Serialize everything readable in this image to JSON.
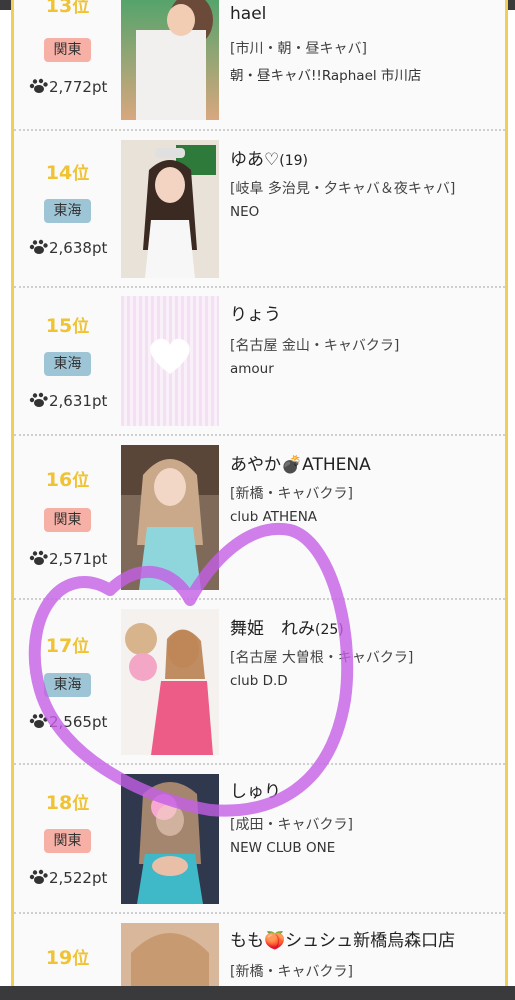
{
  "colors": {
    "rank": "#efc333",
    "kanto_badge": "#f7b0a6",
    "tokai_badge": "#9ec5d6",
    "frame": "#f0cf55",
    "scribble": "#c45fe6"
  },
  "entries": [
    {
      "rank_num": "13",
      "rank_unit": "位",
      "region": "関東",
      "points": "2,772pt",
      "name": "hael",
      "age": "",
      "area": "[市川・朝・昼キャバ]",
      "store": "朝・昼キャバ!!Raphael 市川店"
    },
    {
      "rank_num": "14",
      "rank_unit": "位",
      "region": "東海",
      "points": "2,638pt",
      "name": "ゆあ♡",
      "age": "(19)",
      "area": "[岐阜 多治見・夕キャバ＆夜キャバ]",
      "store": "NEO"
    },
    {
      "rank_num": "15",
      "rank_unit": "位",
      "region": "東海",
      "points": "2,631pt",
      "name": "りょう",
      "age": "",
      "area": "[名古屋 金山・キャバクラ]",
      "store": "amour"
    },
    {
      "rank_num": "16",
      "rank_unit": "位",
      "region": "関東",
      "points": "2,571pt",
      "name": "あやか💣ATHENA",
      "age": "",
      "area": "[新橋・キャバクラ]",
      "store": "club ATHENA"
    },
    {
      "rank_num": "17",
      "rank_unit": "位",
      "region": "東海",
      "points": "2,565pt",
      "name": "舞姫　れみ",
      "age": "(25)",
      "area": "[名古屋 大曽根・キャバクラ]",
      "store": "club D.D"
    },
    {
      "rank_num": "18",
      "rank_unit": "位",
      "region": "関東",
      "points": "2,522pt",
      "name": "しゅり",
      "age": "",
      "area": "[成田・キャバクラ]",
      "store": "NEW CLUB ONE"
    },
    {
      "rank_num": "19",
      "rank_unit": "位",
      "region": "",
      "points": "",
      "name": "もも🍑シュシュ新橋烏森口店",
      "age": "",
      "area": "[新橋・キャバクラ]",
      "store": ""
    }
  ]
}
